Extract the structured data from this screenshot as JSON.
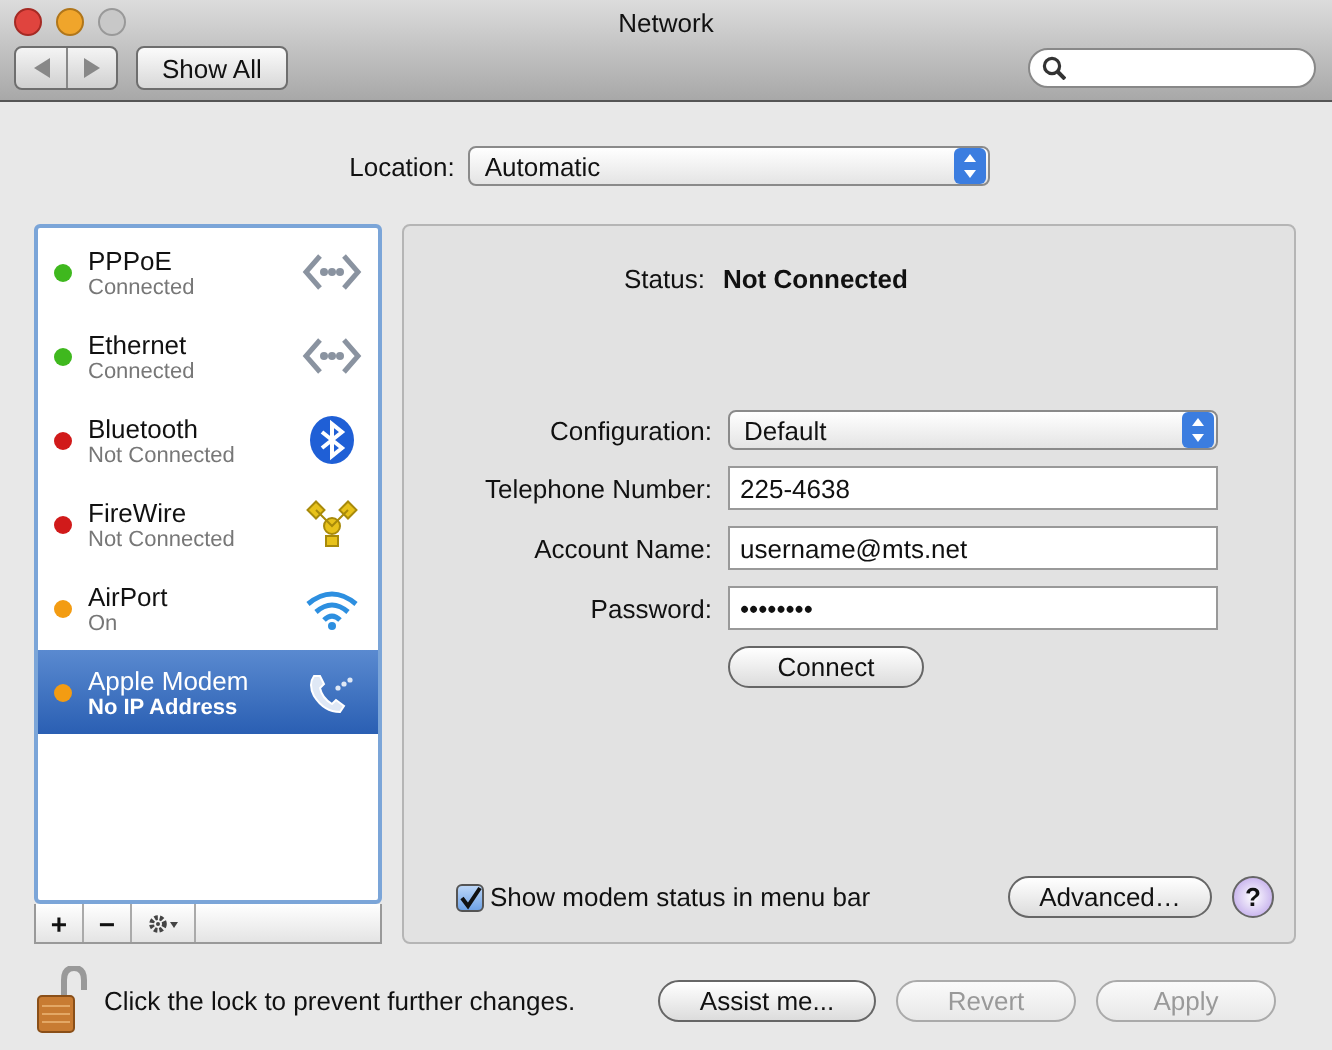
{
  "window": {
    "title": "Network"
  },
  "toolbar": {
    "show_all": "Show All"
  },
  "location": {
    "label": "Location:",
    "value": "Automatic"
  },
  "services": [
    {
      "name": "PPPoE",
      "status": "Connected",
      "color": "#3fb81e",
      "kind": "ethernet",
      "selected": false
    },
    {
      "name": "Ethernet",
      "status": "Connected",
      "color": "#3fb81e",
      "kind": "ethernet",
      "selected": false
    },
    {
      "name": "Bluetooth",
      "status": "Not Connected",
      "color": "#d11a1a",
      "kind": "bluetooth",
      "selected": false
    },
    {
      "name": "FireWire",
      "status": "Not Connected",
      "color": "#d11a1a",
      "kind": "firewire",
      "selected": false
    },
    {
      "name": "AirPort",
      "status": "On",
      "color": "#f39c12",
      "kind": "wifi",
      "selected": false
    },
    {
      "name": "Apple Modem",
      "status": "No IP Address",
      "color": "#f39c12",
      "kind": "modem",
      "selected": true
    }
  ],
  "list_buttons": [
    "+",
    "−"
  ],
  "detail": {
    "status_label": "Status:",
    "status_value": "Not Connected",
    "fields": [
      {
        "kind": "popup",
        "label": "Configuration:",
        "value": "Default"
      },
      {
        "kind": "text",
        "label": "Telephone Number:",
        "value": "225-4638"
      },
      {
        "kind": "text",
        "label": "Account Name:",
        "value": "username@mts.net"
      },
      {
        "kind": "text",
        "label": "Password:",
        "value": "••••••••"
      }
    ],
    "connect": "Connect",
    "show_status": {
      "label": "Show modem status in menu bar",
      "checked": true
    },
    "advanced": "Advanced…",
    "help": "?"
  },
  "lock": {
    "text": "Click the lock to prevent further changes."
  },
  "buttons": [
    {
      "label": "Assist me...",
      "disabled": false
    },
    {
      "label": "Revert",
      "disabled": true
    },
    {
      "label": "Apply",
      "disabled": true
    }
  ]
}
